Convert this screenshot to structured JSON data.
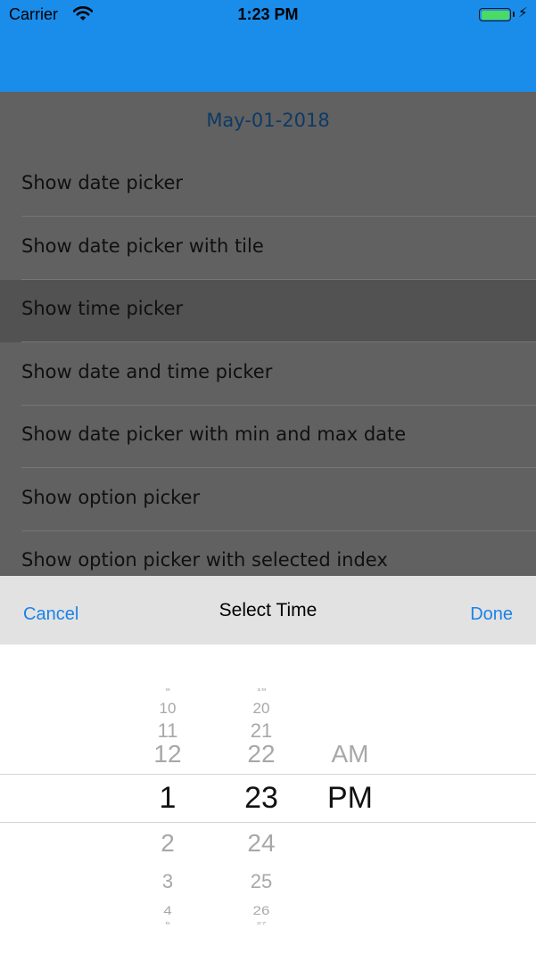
{
  "status_bar": {
    "carrier": "Carrier",
    "time": "1:23 PM"
  },
  "header": {
    "date": "May-01-2018"
  },
  "list": {
    "items": [
      {
        "label": "Show date picker"
      },
      {
        "label": "Show date picker with tile"
      },
      {
        "label": "Show time picker",
        "selected": true
      },
      {
        "label": "Show date and time picker"
      },
      {
        "label": "Show date picker with min and max date"
      },
      {
        "label": "Show option picker"
      },
      {
        "label": "Show option picker with selected index"
      }
    ]
  },
  "picker_toolbar": {
    "cancel": "Cancel",
    "title": "Select Time",
    "done": "Done"
  },
  "time_picker": {
    "hours": {
      "above": [
        "9",
        "10",
        "11",
        "12"
      ],
      "selected": "1",
      "below": [
        "2",
        "3",
        "4",
        "5"
      ]
    },
    "minutes": {
      "above": [
        "19",
        "20",
        "21",
        "22"
      ],
      "selected": "23",
      "below": [
        "24",
        "25",
        "26",
        "27"
      ]
    },
    "period": {
      "above": [
        "AM"
      ],
      "selected": "PM"
    }
  },
  "colors": {
    "accent": "#1a8cea",
    "toolbar_button": "#1a83e8",
    "date_header": "#0e3a64",
    "overlay": "#616161",
    "selected_row": "#525252"
  }
}
